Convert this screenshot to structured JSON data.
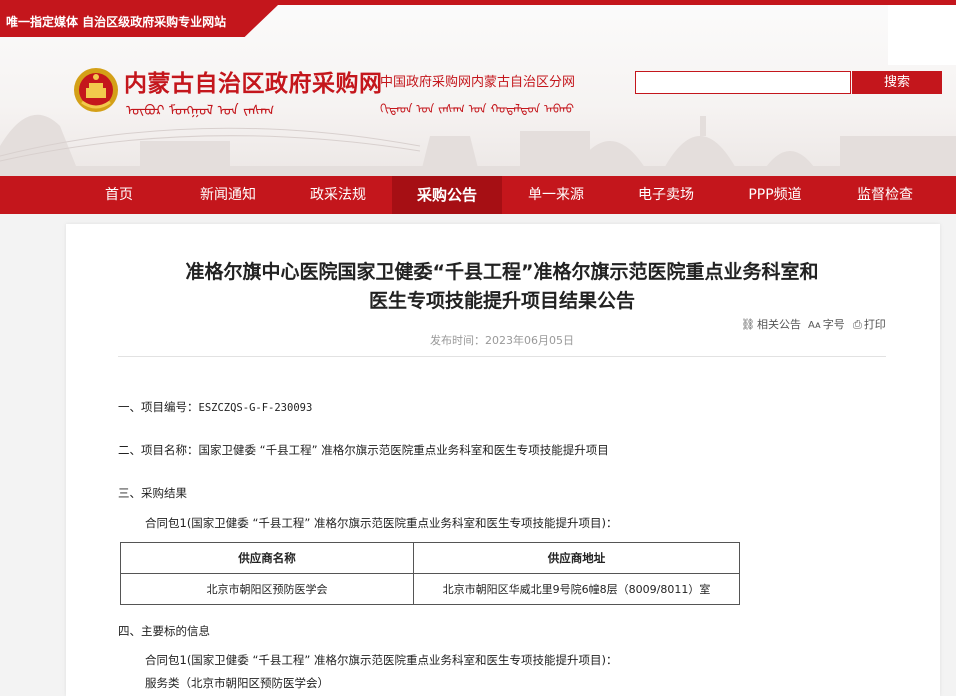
{
  "header": {
    "tagline": "唯一指定媒体  自治区级政府采购专业网站",
    "site_title": "内蒙古自治区政府采购网",
    "site_subtitle": "中国政府采购网内蒙古自治区分网",
    "mongolian_title": "ᠥᠪᠥᠷ ᠮᠣᠩᠭᠣᠯ ᠤᠨ ᠵᠠᠰᠠᠭ",
    "mongolian_subtitle": "ᠬᠢᠲᠠᠳ ᠤᠨ ᠵᠠᠰᠠᠭ ᠤᠨ ᠬᠤᠳᠠᠯᠳᠤᠨ ᠠᠪᠬᠤ",
    "search_placeholder": "",
    "search_button": "搜索",
    "brand_color": "#c4161c"
  },
  "nav": {
    "items": [
      {
        "label": "首页",
        "active": false
      },
      {
        "label": "新闻通知",
        "active": false
      },
      {
        "label": "政采法规",
        "active": false
      },
      {
        "label": "采购公告",
        "active": true
      },
      {
        "label": "单一来源",
        "active": false
      },
      {
        "label": "电子卖场",
        "active": false
      },
      {
        "label": "PPP频道",
        "active": false
      },
      {
        "label": "监督检查",
        "active": false
      }
    ]
  },
  "article": {
    "title_line1": "准格尔旗中心医院国家卫健委“千县工程”准格尔旗示范医院重点业务科室和",
    "title_line2": "医生专项技能提升项目结果公告",
    "publish_time": "发布时间：2023年06月05日",
    "tools": {
      "related": "相关公告",
      "font_size": "字号",
      "print": "打印"
    },
    "sec1_label": "一、项目编号：",
    "sec1_value": "ESZCZQS-G-F-230093",
    "sec2": "二、项目名称：国家卫健委 “千县工程” 准格尔旗示范医院重点业务科室和医生专项技能提升项目",
    "sec3": "三、采购结果",
    "contract1": "合同包1(国家卫健委 “千县工程” 准格尔旗示范医院重点业务科室和医生专项技能提升项目)：",
    "table": {
      "headers": [
        "供应商名称",
        "供应商地址"
      ],
      "rows": [
        [
          "北京市朝阳区预防医学会",
          "北京市朝阳区华威北里9号院6幢8层（8009/8011）室"
        ]
      ]
    },
    "sec4": "四、主要标的信息",
    "contract1b": "合同包1(国家卫健委 “千县工程” 准格尔旗示范医院重点业务科室和医生专项技能提升项目)：",
    "service_line": "服务类（北京市朝阳区预防医学会）"
  }
}
